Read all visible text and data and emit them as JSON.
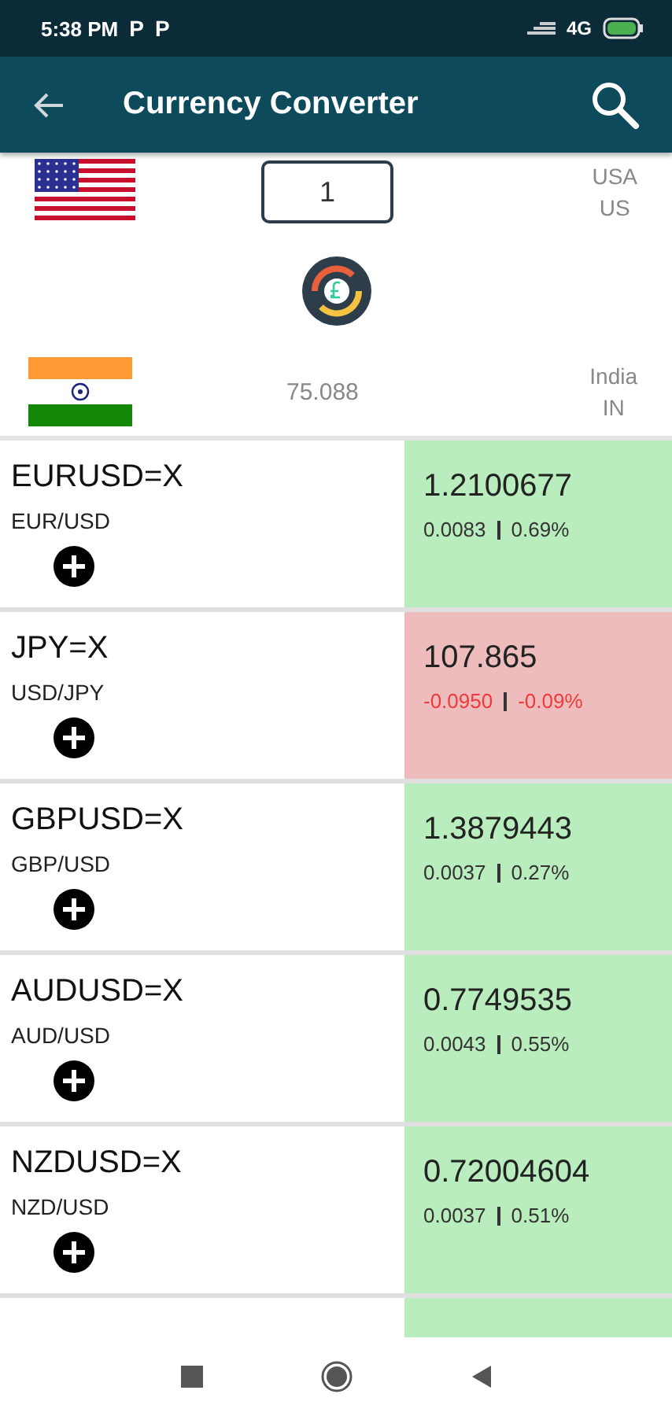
{
  "status_bar": {
    "time": "5:38 PM",
    "notification_icons": [
      "P",
      "P"
    ],
    "network": "4G"
  },
  "app_bar": {
    "title": "Currency Converter"
  },
  "converter": {
    "from": {
      "amount": "1",
      "country": "USA",
      "code": "US"
    },
    "to": {
      "result": "75.088",
      "country": "India",
      "code": "IN"
    }
  },
  "rates": [
    {
      "symbol": "EURUSD=X",
      "pair": "EUR/USD",
      "price": "1.2100677",
      "change": "0.0083",
      "percent": "0.69%",
      "rising": true
    },
    {
      "symbol": "JPY=X",
      "pair": "USD/JPY",
      "price": "107.865",
      "change": "-0.0950",
      "percent": "-0.09%",
      "rising": false
    },
    {
      "symbol": "GBPUSD=X",
      "pair": "GBP/USD",
      "price": "1.3879443",
      "change": "0.0037",
      "percent": "0.27%",
      "rising": true
    },
    {
      "symbol": "AUDUSD=X",
      "pair": "AUD/USD",
      "price": "0.7749535",
      "change": "0.0043",
      "percent": "0.55%",
      "rising": true
    },
    {
      "symbol": "NZDUSD=X",
      "pair": "NZD/USD",
      "price": "0.72004604",
      "change": "0.0037",
      "percent": "0.51%",
      "rising": true
    },
    {
      "rising": true
    }
  ]
}
